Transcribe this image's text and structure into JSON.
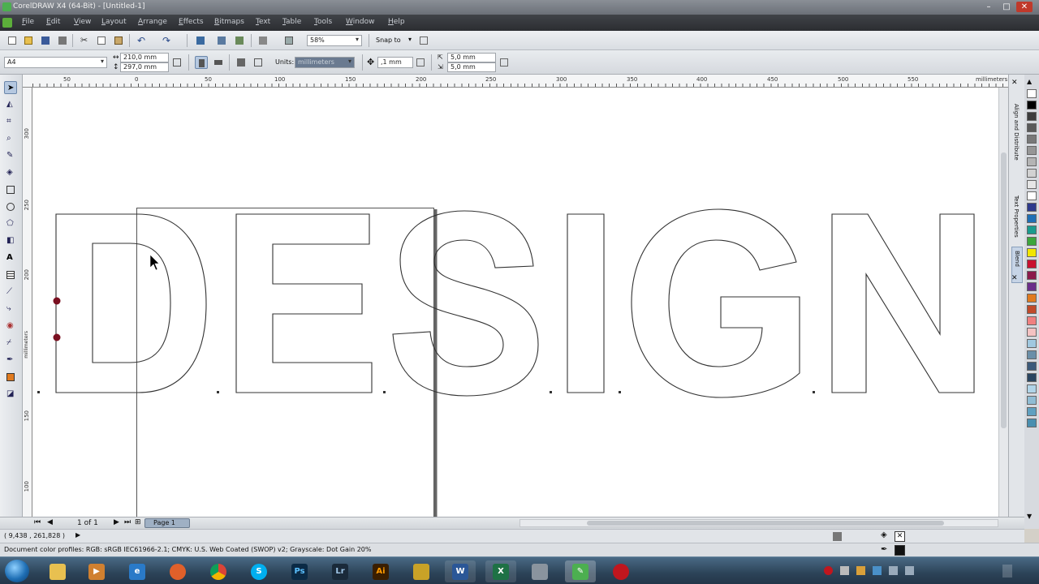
{
  "window": {
    "title": "CorelDRAW X4 (64-Bit) - [Untitled-1]"
  },
  "menu": [
    "File",
    "Edit",
    "View",
    "Layout",
    "Arrange",
    "Effects",
    "Bitmaps",
    "Text",
    "Table",
    "Tools",
    "Window",
    "Help"
  ],
  "toolbar": {
    "zoom": "58%",
    "snap_to": "Snap to"
  },
  "propbar": {
    "paper_preset": "A4",
    "width": "210,0 mm",
    "height": "297,0 mm",
    "units_label": "Units:",
    "units_value": "millimeters",
    "nudge": ",1 mm",
    "dup_x": "5,0 mm",
    "dup_y": "5,0 mm"
  },
  "ruler": {
    "h_ticks": [
      "50",
      "0",
      "50",
      "100",
      "150",
      "200",
      "250",
      "300",
      "350",
      "400",
      "450",
      "500",
      "550"
    ],
    "h_unit": "millimeters",
    "v_ticks": [
      "300",
      "250",
      "200",
      "150",
      "100"
    ],
    "v_unit": "millimeters"
  },
  "canvas_text": "DESIGN",
  "dockers": [
    "Align and Distribute",
    "Text Properties",
    "Blend"
  ],
  "page_nav": {
    "pages": "1 of 1",
    "page_tab": "Page 1"
  },
  "status": {
    "coords": "( 9,438 , 261,828 )",
    "color_profiles": "Document color profiles: RGB: sRGB IEC61966-2.1; CMYK: U.S. Web Coated (SWOP) v2; Grayscale: Dot Gain 20%"
  },
  "palette_colors": [
    "#ffffff",
    "#000000",
    "#3c3c3c",
    "#5a5a5a",
    "#787878",
    "#969696",
    "#b4b4b4",
    "#d2d2d2",
    "#e6e6e6",
    "#ffffff",
    "#2d3a8c",
    "#1f6fb5",
    "#1a9b8e",
    "#3ca63c",
    "#f2e600",
    "#c8102e",
    "#8b1a4a",
    "#6b2d8a",
    "#e07a1f",
    "#c04a2a",
    "#f08080",
    "#f4c2c2",
    "#a0c8e0",
    "#6b8fa8",
    "#3c5a7a",
    "#2a4560",
    "#b0d4e8",
    "#8fbcd4",
    "#5fa0c0",
    "#4a8fb0"
  ],
  "taskbar": [
    "Start",
    "Explorer",
    "Media",
    "Internet Explorer",
    "Firefox",
    "Chrome",
    "Skype",
    "Photoshop",
    "Lightroom",
    "Illustrator",
    "Gadget",
    "Word",
    "Excel",
    "Calculator",
    "CorelDRAW",
    "Record"
  ]
}
